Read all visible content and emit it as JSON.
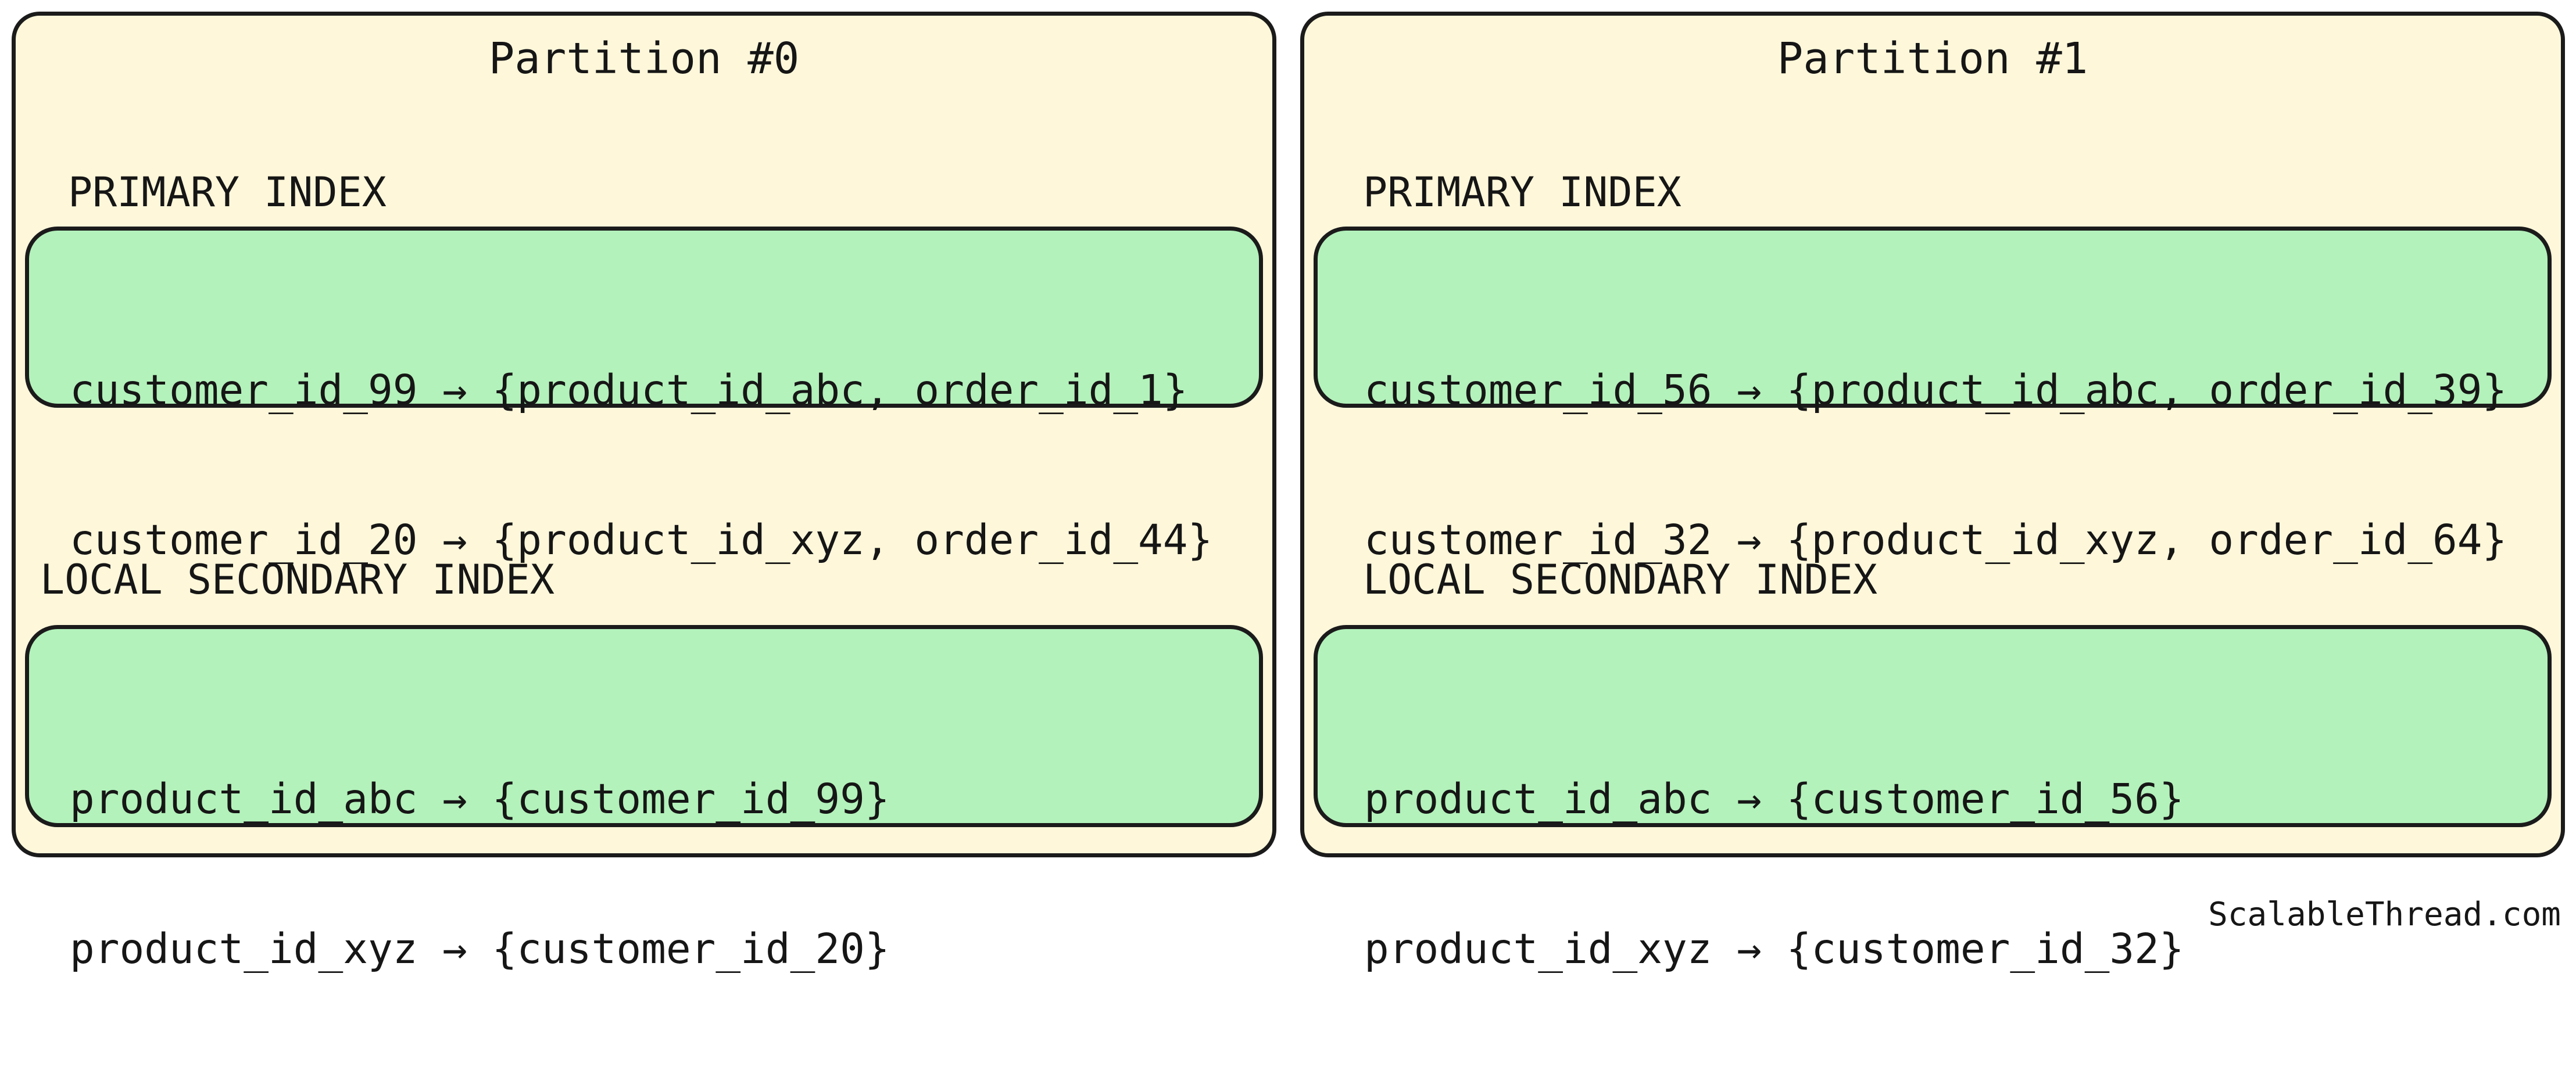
{
  "partitions": [
    {
      "title": "Partition #0",
      "primary_index": {
        "label": "PRIMARY INDEX",
        "entries": [
          "customer_id_99 → {product_id_abc, order_id_1}",
          "customer_id_20 → {product_id_xyz, order_id_44}"
        ]
      },
      "local_secondary_index": {
        "label": "LOCAL SECONDARY INDEX",
        "entries": [
          "product_id_abc → {customer_id_99}",
          "product_id_xyz → {customer_id_20}"
        ]
      }
    },
    {
      "title": "Partition #1",
      "primary_index": {
        "label": "PRIMARY INDEX",
        "entries": [
          "customer_id_56 → {product_id_abc, order_id_39}",
          "customer_id_32 → {product_id_xyz, order_id_64}"
        ]
      },
      "local_secondary_index": {
        "label": "LOCAL SECONDARY INDEX",
        "entries": [
          "product_id_abc → {customer_id_56}",
          "product_id_xyz → {customer_id_32}"
        ]
      }
    }
  ],
  "footer": {
    "credit": "ScalableThread.com"
  },
  "colors": {
    "partition_fill": "#fef7da",
    "index_fill": "#b3f2bb",
    "border": "#1b1b1b",
    "text": "#161616"
  }
}
